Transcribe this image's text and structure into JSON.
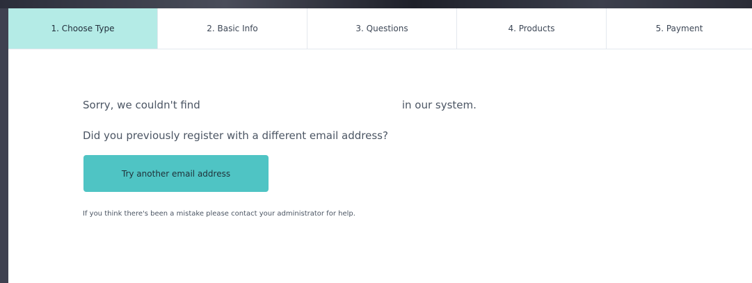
{
  "steps": [
    {
      "label": "1. Choose Type",
      "active": true
    },
    {
      "label": "2. Basic Info",
      "active": false
    },
    {
      "label": "3. Questions",
      "active": false
    },
    {
      "label": "4. Products",
      "active": false
    },
    {
      "label": "5. Payment",
      "active": false
    }
  ],
  "message": {
    "not_found_prefix": "Sorry, we couldn't find",
    "not_found_suffix": "in our system.",
    "question": "Did you previously register with a different email address?",
    "help": "If you think there's been a mistake please contact your administrator for help."
  },
  "actions": {
    "try_another_label": "Try another email address"
  },
  "colors": {
    "active_step": "#b4ebe6",
    "button": "#4fc4c4"
  }
}
